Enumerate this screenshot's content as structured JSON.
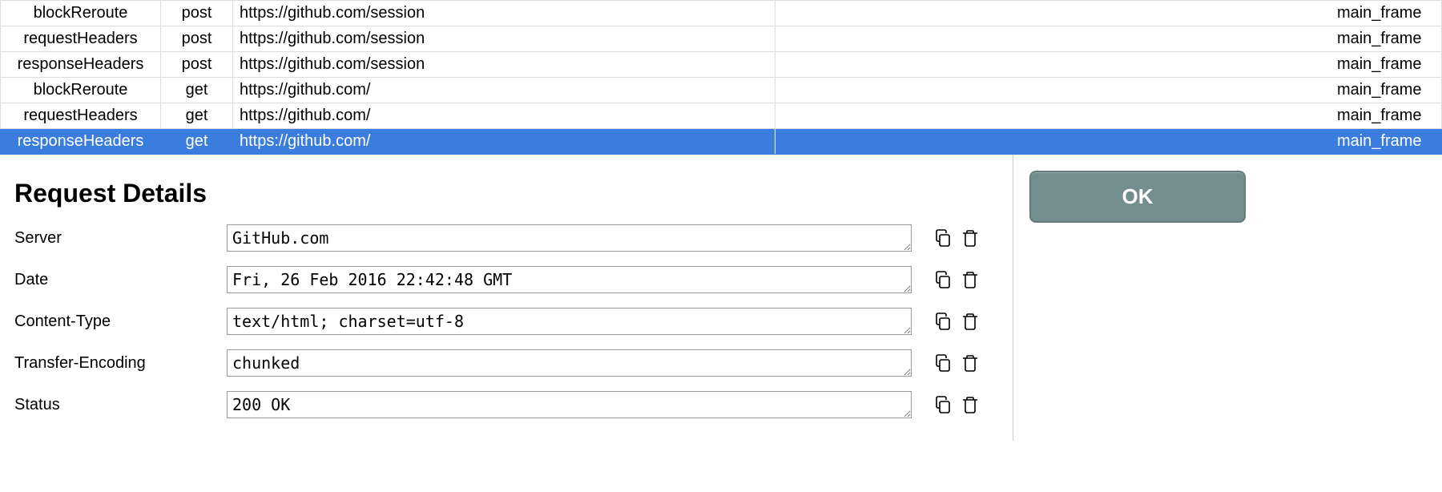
{
  "requests": [
    {
      "event": "blockReroute",
      "method": "post",
      "url": "https://github.com/session",
      "frame": "main_frame",
      "selected": false
    },
    {
      "event": "requestHeaders",
      "method": "post",
      "url": "https://github.com/session",
      "frame": "main_frame",
      "selected": false
    },
    {
      "event": "responseHeaders",
      "method": "post",
      "url": "https://github.com/session",
      "frame": "main_frame",
      "selected": false
    },
    {
      "event": "blockReroute",
      "method": "get",
      "url": "https://github.com/",
      "frame": "main_frame",
      "selected": false
    },
    {
      "event": "requestHeaders",
      "method": "get",
      "url": "https://github.com/",
      "frame": "main_frame",
      "selected": false
    },
    {
      "event": "responseHeaders",
      "method": "get",
      "url": "https://github.com/",
      "frame": "main_frame",
      "selected": true
    }
  ],
  "details": {
    "title": "Request Details",
    "fields": [
      {
        "label": "Server",
        "value": "GitHub.com"
      },
      {
        "label": "Date",
        "value": "Fri, 26 Feb 2016 22:42:48 GMT"
      },
      {
        "label": "Content-Type",
        "value": "text/html; charset=utf-8"
      },
      {
        "label": "Transfer-Encoding",
        "value": "chunked"
      },
      {
        "label": "Status",
        "value": "200 OK"
      }
    ]
  },
  "buttons": {
    "ok": "OK"
  }
}
